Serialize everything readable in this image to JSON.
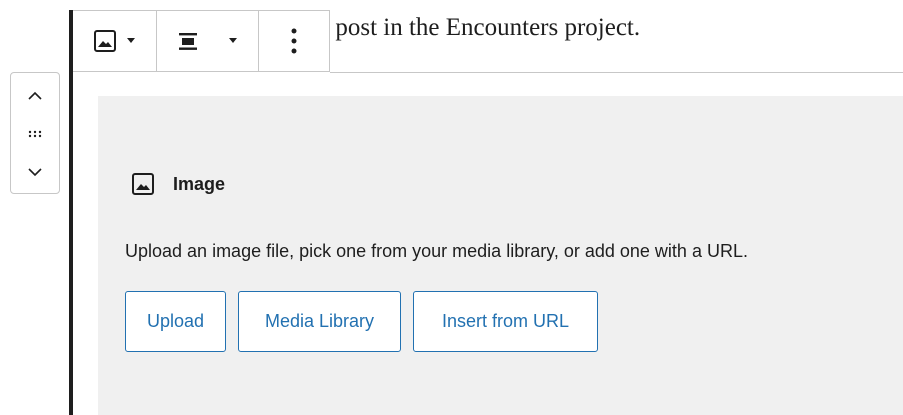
{
  "paragraph": {
    "text": "e post in the Encounters project."
  },
  "toolbar": {
    "block_type_icon": "image-icon",
    "align_icon": "align-center-icon",
    "more_icon": "more-vertical-icon"
  },
  "mover": {
    "up_icon": "chevron-up-icon",
    "drag_icon": "drag-handle-icon",
    "down_icon": "chevron-down-icon"
  },
  "placeholder": {
    "icon": "image-icon",
    "title": "Image",
    "instructions": "Upload an image file, pick one from your media library, or add one with a URL.",
    "buttons": {
      "upload": "Upload",
      "media_library": "Media Library",
      "insert_url": "Insert from URL"
    }
  },
  "colors": {
    "accent": "#2271b1",
    "placeholder_bg": "#f0f0f0",
    "border": "#c7c7c7",
    "text": "#1e1e1e"
  }
}
